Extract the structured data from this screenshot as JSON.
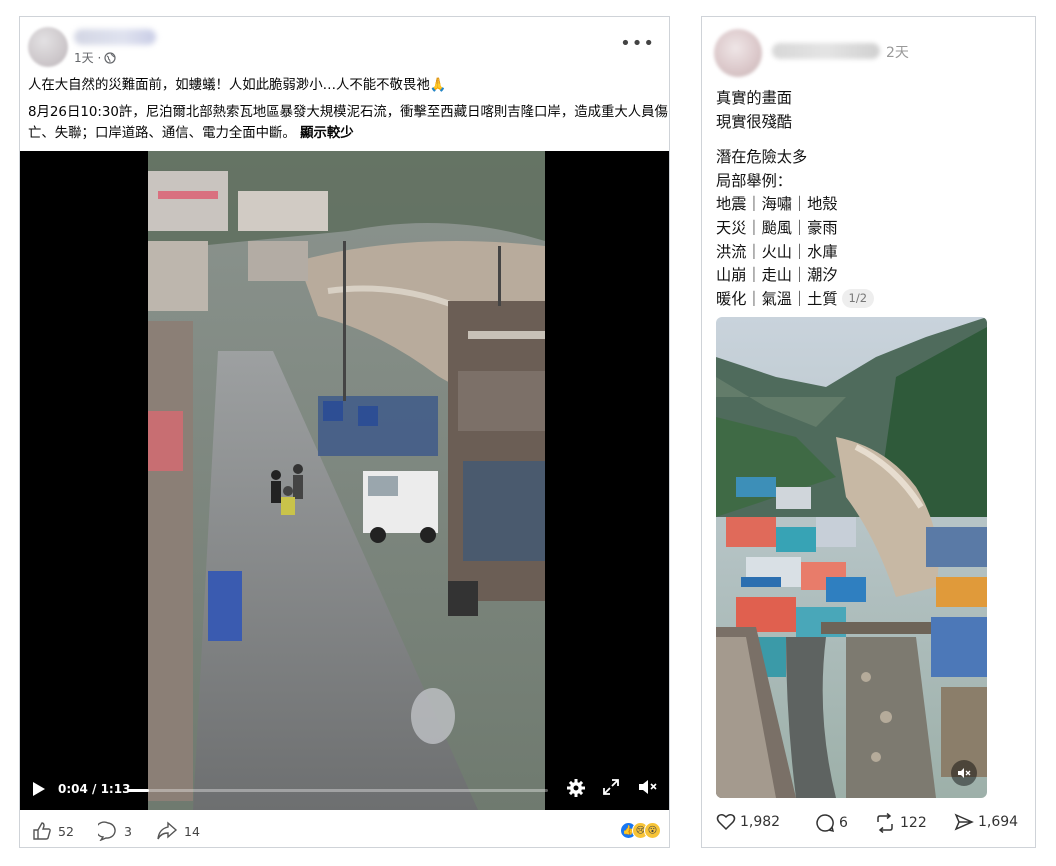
{
  "facebook_post": {
    "time": "1天 ·",
    "privacy_icon": "globe-icon",
    "more_icon": "more-dots-icon",
    "line1": "人在大自然的災難面前，如螻蟻！人如此脆弱渺小…人不能不敬畏祂🙏",
    "line2": "8月26日10:30許，尼泊爾北部熱索瓦地區暴發大規模泥石流，衝擊至西藏日喀則吉隆口岸，造成重大人員傷亡、失聯；口岸道路、通信、電力全面中斷。",
    "see_less": "顯示較少",
    "video": {
      "time_display": "0:04 / 1:13",
      "progress": 0.05
    },
    "likes": "52",
    "comments": "3",
    "shares": "14",
    "reactions": [
      "like",
      "sad",
      "wow"
    ]
  },
  "threads_post": {
    "time": "2天",
    "lines_a": [
      "真實的畫面",
      "現實很殘酷"
    ],
    "lines_b": [
      "潛在危險太多",
      "局部舉例：",
      "地震｜海嘯｜地殼",
      "天災｜颱風｜豪雨",
      "洪流｜火山｜水庫",
      "山崩｜走山｜潮汐",
      "暖化｜氣溫｜土質"
    ],
    "page_counter": "1/2",
    "likes": "1,982",
    "replies": "6",
    "reposts": "122",
    "shares": "1,694"
  }
}
